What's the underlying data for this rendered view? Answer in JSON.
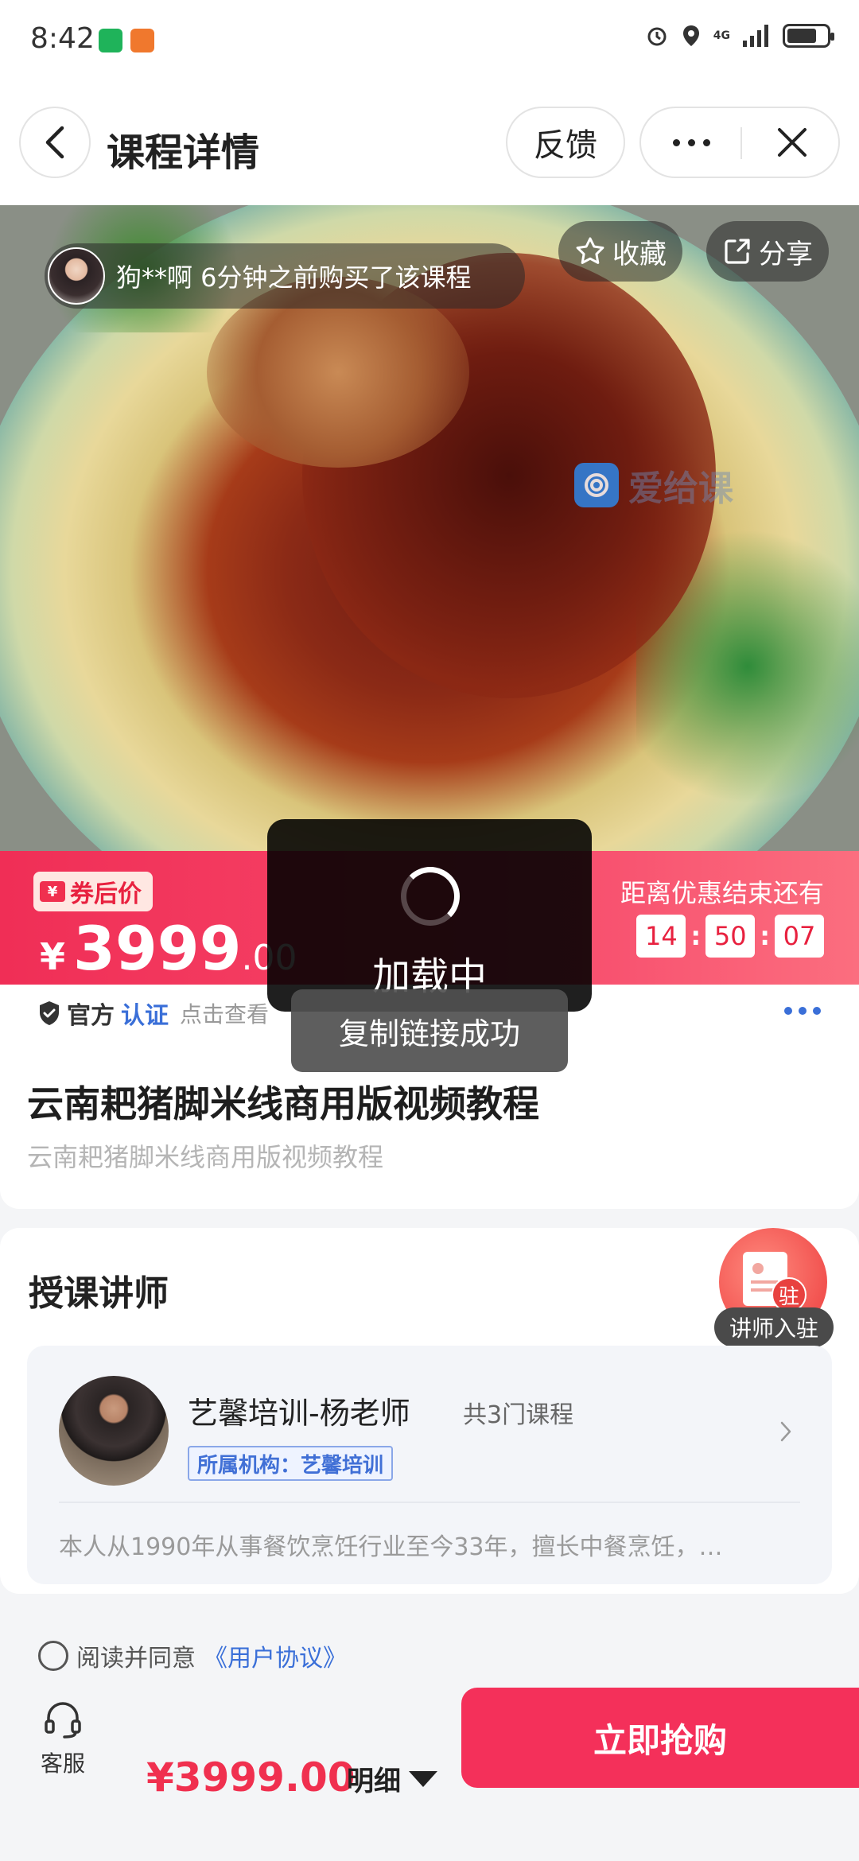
{
  "status_bar": {
    "time": "8:42",
    "network": "4G"
  },
  "header": {
    "back_icon": "chevron-left-icon",
    "title": "课程详情",
    "feedback": "反馈",
    "more_icon": "more-icon",
    "close_icon": "close-icon"
  },
  "hero": {
    "buyer_notice": "狗**啊 6分钟之前购买了该课程",
    "favorite": "收藏",
    "share": "分享",
    "watermark": "爱给课"
  },
  "price_bar": {
    "coupon_symbol": "¥",
    "coupon_label": "券后价",
    "currency": "¥",
    "price_int": "3999",
    "price_dec": ".00",
    "countdown_title": "距离优惠结束还有",
    "countdown": {
      "hh": "14",
      "mm": "50",
      "ss": "07"
    }
  },
  "official": {
    "a": "官方",
    "b": "认证",
    "c": "点击查看"
  },
  "course": {
    "title": "云南耙猪脚米线商用版视频教程",
    "subtitle": "云南耙猪脚米线商用版视频教程"
  },
  "instructor_section": {
    "title": "授课讲师",
    "join_stamp": "驻",
    "join_label": "讲师入驻",
    "teacher": {
      "name": "艺馨培训-杨老师",
      "course_count": "共3门课程",
      "org": "所属机构：艺馨培训",
      "bio": "本人从1990年从事餐饮烹饪行业至今33年，擅长中餐烹饪，…"
    }
  },
  "agreement": {
    "text": "阅读并同意",
    "link": "《用户协议》"
  },
  "bottom": {
    "service": "客服",
    "price": "¥3999.00",
    "detail": "明细",
    "buy": "立即抢购"
  },
  "overlays": {
    "loading": "加载中",
    "copy_success": "复制链接成功"
  },
  "colors": {
    "accent": "#f4305a",
    "link": "#3a6fd8"
  }
}
